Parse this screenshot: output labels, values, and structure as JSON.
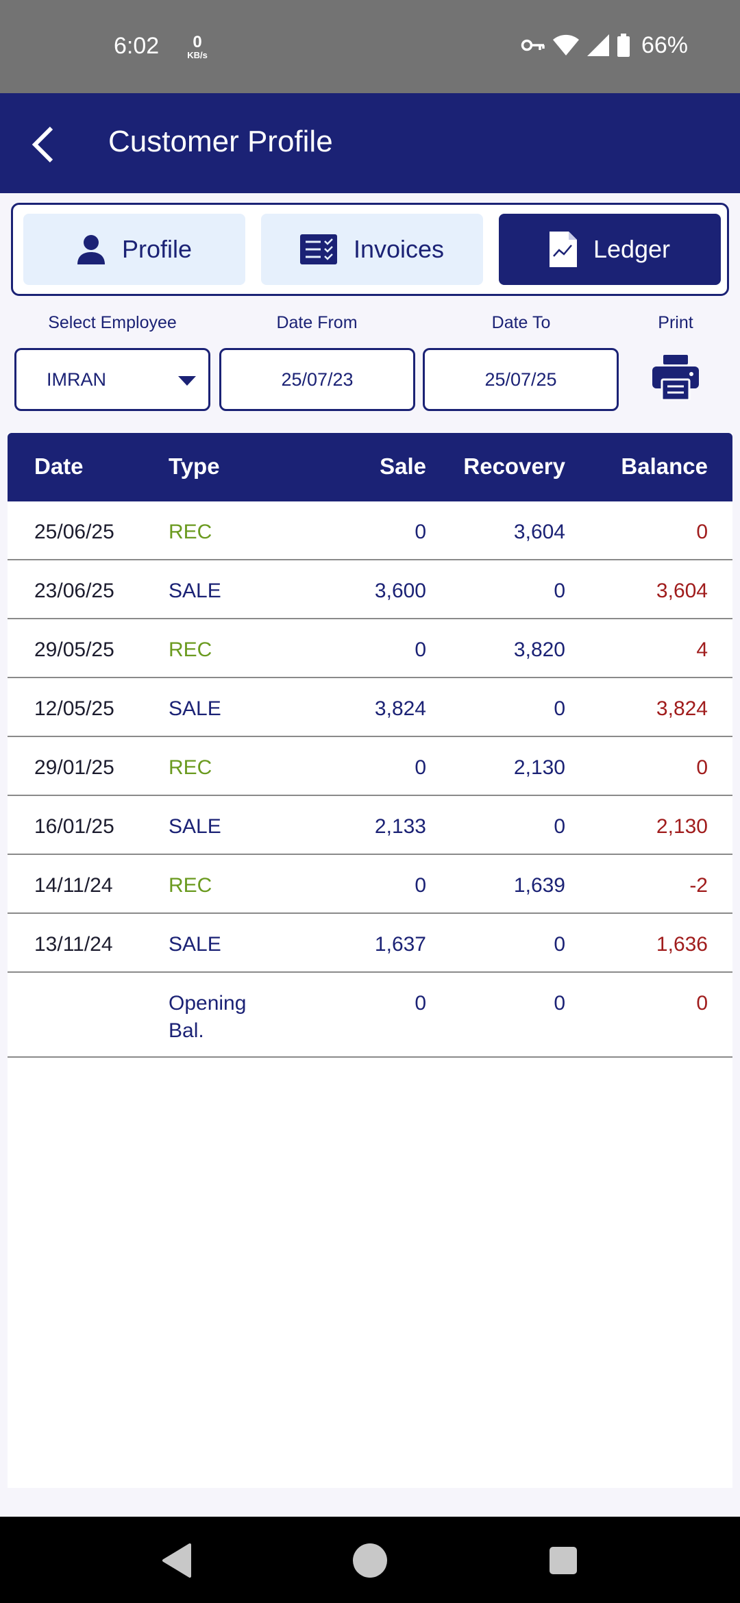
{
  "status_bar": {
    "time": "6:02",
    "net_speed_value": "0",
    "net_speed_unit": "KB/s",
    "battery_percent": "66%",
    "icons": [
      "vpn-key-icon",
      "wifi-icon",
      "cell-signal-icon",
      "battery-icon"
    ]
  },
  "app_bar": {
    "title": "Customer Profile",
    "back_icon": "back-arrow-icon"
  },
  "tabs": [
    {
      "label": "Profile",
      "icon": "person-icon",
      "active": false
    },
    {
      "label": "Invoices",
      "icon": "invoice-list-icon",
      "active": false
    },
    {
      "label": "Ledger",
      "icon": "chart-document-icon",
      "active": true
    }
  ],
  "filters": {
    "employee_label": "Select Employee",
    "employee_value": "IMRAN",
    "date_from_label": "Date From",
    "date_from_value": "25/07/23",
    "date_to_label": "Date To",
    "date_to_value": "25/07/25",
    "print_label": "Print"
  },
  "ledger": {
    "columns": [
      "Date",
      "Type",
      "Sale",
      "Recovery",
      "Balance"
    ],
    "rows": [
      {
        "date": "25/06/25",
        "type": "REC",
        "sale": "0",
        "recovery": "3,604",
        "balance": "0"
      },
      {
        "date": "23/06/25",
        "type": "SALE",
        "sale": "3,600",
        "recovery": "0",
        "balance": "3,604"
      },
      {
        "date": "29/05/25",
        "type": "REC",
        "sale": "0",
        "recovery": "3,820",
        "balance": "4"
      },
      {
        "date": "12/05/25",
        "type": "SALE",
        "sale": "3,824",
        "recovery": "0",
        "balance": "3,824"
      },
      {
        "date": "29/01/25",
        "type": "REC",
        "sale": "0",
        "recovery": "2,130",
        "balance": "0"
      },
      {
        "date": "16/01/25",
        "type": "SALE",
        "sale": "2,133",
        "recovery": "0",
        "balance": "2,130"
      },
      {
        "date": "14/11/24",
        "type": "REC",
        "sale": "0",
        "recovery": "1,639",
        "balance": "-2"
      },
      {
        "date": "13/11/24",
        "type": "SALE",
        "sale": "1,637",
        "recovery": "0",
        "balance": "1,636"
      },
      {
        "date": "",
        "type": "Opening\nBal.",
        "sale": "0",
        "recovery": "0",
        "balance": "0"
      }
    ]
  },
  "colors": {
    "primary": "#1b2275",
    "tab_inactive_bg": "#e6f0fc",
    "rec_type": "#6a9a1f",
    "balance": "#a01c1c",
    "status_bar": "#737373"
  }
}
